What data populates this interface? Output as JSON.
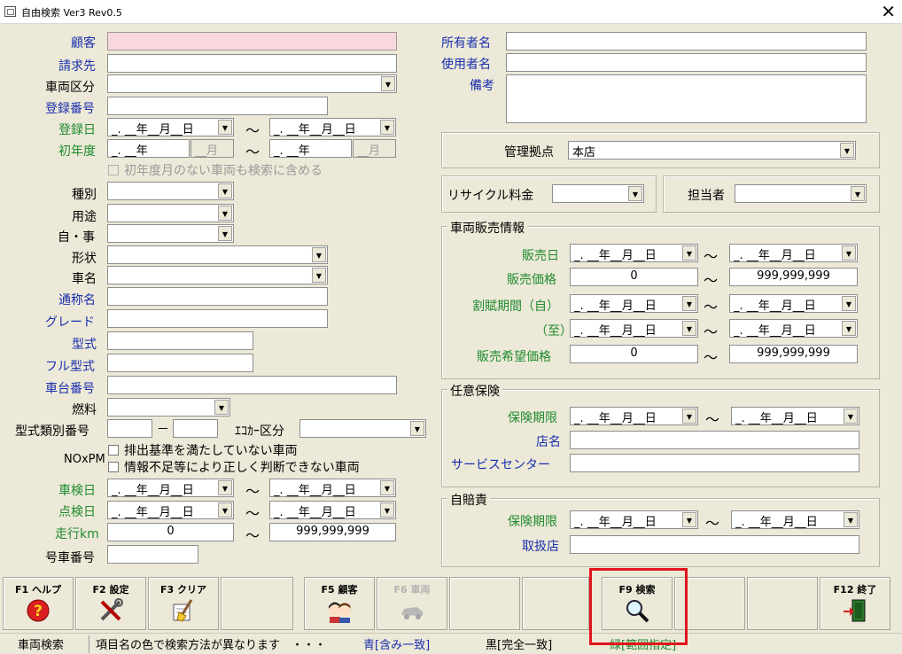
{
  "window": {
    "title": "自由検索 Ver3 Rev0.5",
    "close_glyph": "✕"
  },
  "labels": {
    "customer": "顧客",
    "billing": "請求先",
    "vehicle_class": "車両区分",
    "reg_no": "登録番号",
    "reg_date": "登録日",
    "first_year": "初年度",
    "no_first_month": "初年度月のない車両も検索に含める",
    "kind": "種別",
    "usage": "用途",
    "own_biz": "自・事",
    "shape": "形状",
    "car_name": "車名",
    "common_name": "通称名",
    "grade": "グレード",
    "model": "型式",
    "full_model": "フル型式",
    "chassis_no": "車台番号",
    "fuel": "燃料",
    "model_class_no": "型式類別番号",
    "eco_class": "ｴｺｶｰ区分",
    "nox": "NOxPM",
    "nox1": "排出基準を満たしていない車両",
    "nox2": "情報不足等により正しく判断できない車両",
    "inspection": "車検日",
    "check": "点検日",
    "mileage": "走行km",
    "car_number": "号車番号",
    "owner": "所有者名",
    "user": "使用者名",
    "notes": "備考",
    "base": "管理拠点",
    "recycle": "リサイクル料金",
    "staff": "担当者",
    "sales_group": "車両販売情報",
    "sale_date": "販売日",
    "sale_price": "販売価格",
    "installment_from": "割賦期間（自）",
    "installment_to": "（至）",
    "desired_price": "販売希望価格",
    "ins_group": "任意保険",
    "ins_limit": "保険期限",
    "shop": "店名",
    "service": "サービスセンター",
    "cali_group": "自賠責",
    "cali_limit": "保険期限",
    "handler": "取扱店"
  },
  "values": {
    "date_empty": "_. __年__月__日",
    "year_empty": "_. __年",
    "month_empty": "__月",
    "dash": "－",
    "tilde": "～",
    "base": "本店",
    "price_min": "0",
    "price_max": "999,999,999",
    "km_min": "0",
    "km_max": "999,999,999"
  },
  "fkeys": [
    {
      "label": "F1 ヘルプ",
      "icon": "help-icon"
    },
    {
      "label": "F2 設定",
      "icon": "tools-icon"
    },
    {
      "label": "F3 クリア",
      "icon": "clear-brush-icon"
    },
    {
      "label": "F5 顧客",
      "icon": "customers-icon"
    },
    {
      "label": "F6 車両",
      "icon": "car-icon"
    },
    {
      "label": "F9 検索",
      "icon": "magnifier-icon"
    },
    {
      "label": "F12 終了",
      "icon": "exit-door-icon"
    }
  ],
  "status": {
    "mode": "車両検索",
    "hint": "項目名の色で検索方法が異なります　・・・",
    "blue": "青[含み一致]",
    "black": "黒[完全一致]",
    "green": "緑[範囲指定]"
  },
  "colors": {
    "blue": "#1a2fae",
    "green": "#1e8b2e",
    "pink": "#f9d7df",
    "highlight": "#e0151c"
  }
}
